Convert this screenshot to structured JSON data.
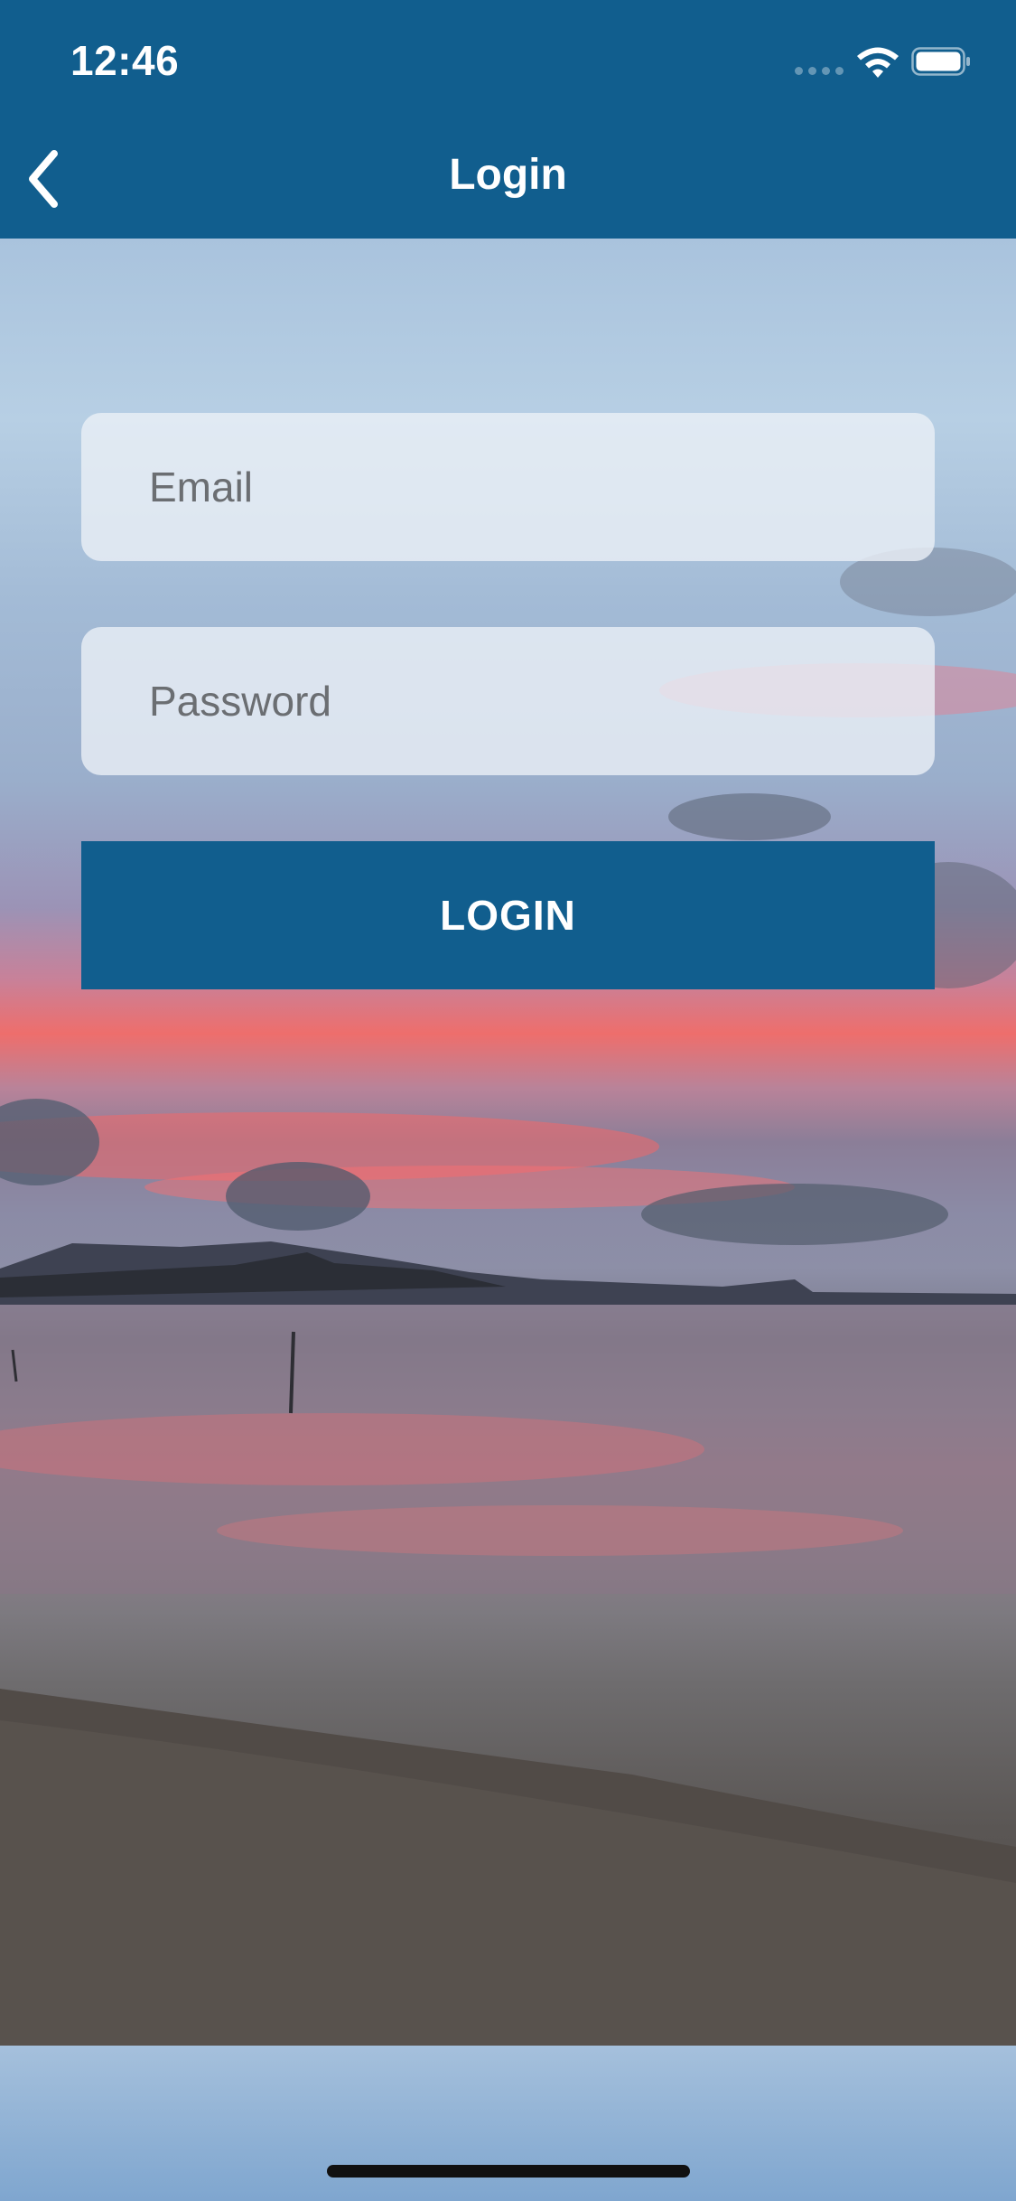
{
  "status_bar": {
    "time": "12:46",
    "icons": [
      "cellular-signal-icon",
      "wifi-icon",
      "battery-icon"
    ]
  },
  "nav_bar": {
    "back_icon": "chevron-left-icon",
    "title": "Login"
  },
  "form": {
    "email": {
      "value": "",
      "placeholder": "Email"
    },
    "password": {
      "value": "",
      "placeholder": "Password"
    },
    "login_label": "LOGIN"
  },
  "colors": {
    "primary": "#115e8e",
    "field_background": "#ebf0f6",
    "text_on_primary": "#ffffff",
    "placeholder": "#6b6e72"
  }
}
